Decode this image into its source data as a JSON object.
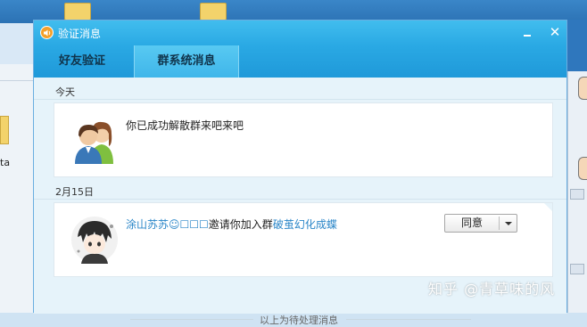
{
  "window": {
    "title": "验证消息",
    "minimize_label": "_",
    "close_label": "✕"
  },
  "tabs": [
    {
      "label": "好友验证",
      "active": false
    },
    {
      "label": "群系统消息",
      "active": true
    }
  ],
  "background": {
    "partial_text": "ta"
  },
  "sections": [
    {
      "date": "今天",
      "message": {
        "avatar": "couple-avatar-icon",
        "text": "你已成功解散群来吧来吧"
      }
    },
    {
      "date": "2月15日",
      "message": {
        "avatar": "anime-character-avatar",
        "sender": "涂山苏苏☺☐☐☐",
        "action": "邀请你加入群",
        "group": "破茧幻化成蝶",
        "button_label": "同意",
        "dropdown_icon": "chevron-down-icon"
      }
    }
  ],
  "footer": {
    "text": "以上为待处理消息"
  },
  "watermark": {
    "text": "知乎 @青草味的风"
  },
  "colors": {
    "titlebar": "#2aa9e4",
    "active_tab": "#3fb6ea",
    "link": "#2a86c8",
    "panel_bg": "#e6f3fa"
  }
}
